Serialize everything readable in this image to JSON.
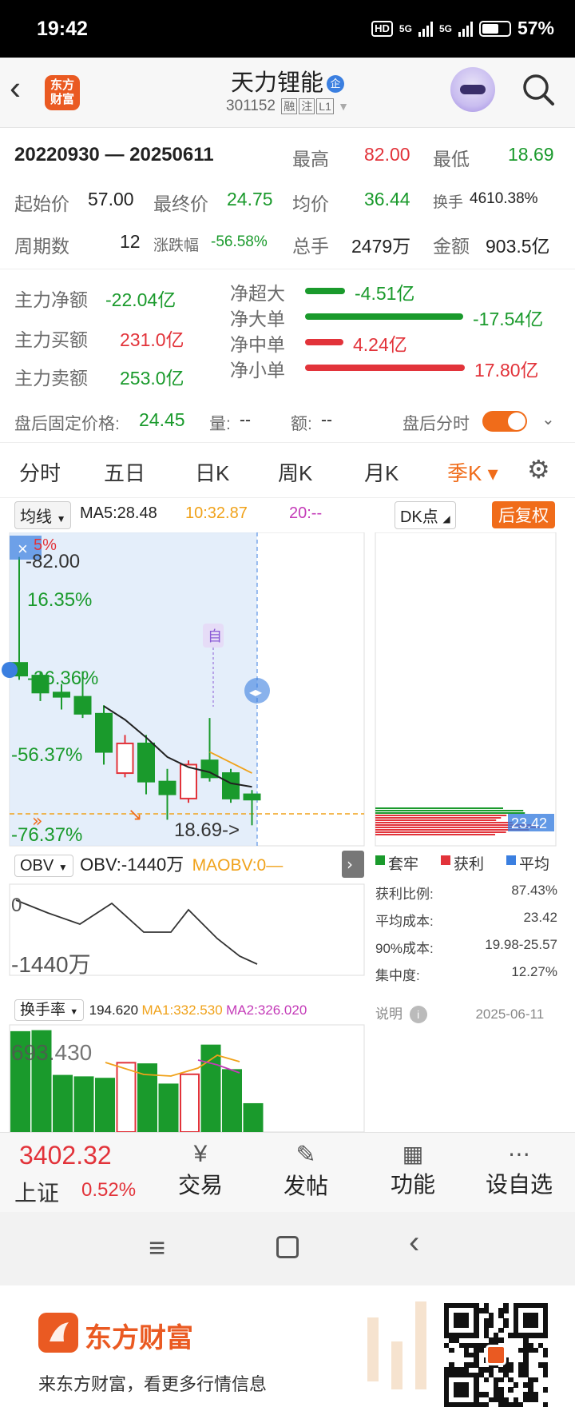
{
  "status_bar": {
    "time": "19:42",
    "hd": "HD",
    "net1": "5G",
    "net2": "5G",
    "battery": "57%"
  },
  "header": {
    "logo_text": "东方财富",
    "stock_name": "天力锂能",
    "qi_badge": "企",
    "code": "301152",
    "tags": [
      "融",
      "注",
      "L1"
    ]
  },
  "summary": {
    "date_range": "20220930 — 20250611",
    "high_label": "最高",
    "high": "82.00",
    "low_label": "最低",
    "low": "18.69",
    "open_label": "起始价",
    "open": "57.00",
    "close_label": "最终价",
    "close": "24.75",
    "avg_label": "均价",
    "avg": "36.44",
    "turnover_label": "换手",
    "turnover": "4610.38%",
    "periods_label": "周期数",
    "periods": "12",
    "change_label": "涨跌幅",
    "change": "-56.58%",
    "volume_label": "总手",
    "volume": "2479万",
    "amount_label": "金额",
    "amount": "903.5亿"
  },
  "fund_flow": {
    "net_main_label": "主力净额",
    "net_main": "-22.04亿",
    "buy_main_label": "主力买额",
    "buy_main": "231.0亿",
    "sell_main_label": "主力卖额",
    "sell_main": "253.0亿",
    "items": [
      {
        "label": "净超大",
        "value": "-4.51亿",
        "color": "#1a9a2c",
        "fraction": 0.25
      },
      {
        "label": "净大单",
        "value": "-17.54亿",
        "color": "#1a9a2c",
        "fraction": 0.99
      },
      {
        "label": "净中单",
        "value": "4.24亿",
        "color": "#e2333a",
        "fraction": 0.24
      },
      {
        "label": "净小单",
        "value": "17.80亿",
        "color": "#e2333a",
        "fraction": 1.0
      }
    ]
  },
  "after_hours": {
    "price_label": "盘后固定价格:",
    "price": "24.45",
    "vol_label": "量:",
    "vol": "--",
    "amt_label": "额:",
    "amt": "--",
    "toggle_label": "盘后分时"
  },
  "tabs": [
    "分时",
    "五日",
    "日K",
    "周K",
    "月K",
    "季K"
  ],
  "active_tab": "季K",
  "chart_toolbar": {
    "ma_select": "均线",
    "ma5": "MA5:28.48",
    "ma10": "10:32.87",
    "ma20": "20:--",
    "dk_select": "DK点",
    "adjust_button": "后复权"
  },
  "main_chart": {
    "labels": [
      "-82.00",
      "16.35%",
      "-36.36%",
      "-56.37%",
      "-76.37%",
      "18.69->",
      "5%",
      "自",
      "23.42"
    ],
    "colors": {
      "up": "#e2333a",
      "down": "#1a9a2c"
    }
  },
  "chart_data": {
    "type": "candlestick",
    "quarters": 12,
    "ohlc": [
      {
        "o": 57.0,
        "h": 82.0,
        "l": 53.0,
        "c": 54.0
      },
      {
        "o": 54.0,
        "h": 55.0,
        "l": 48.0,
        "c": 50.0
      },
      {
        "o": 50.0,
        "h": 52.0,
        "l": 46.0,
        "c": 49.0
      },
      {
        "o": 49.0,
        "h": 55.0,
        "l": 44.0,
        "c": 45.0
      },
      {
        "o": 45.0,
        "h": 47.0,
        "l": 33.0,
        "c": 36.0
      },
      {
        "o": 31.0,
        "h": 40.0,
        "l": 30.0,
        "c": 38.0
      },
      {
        "o": 38.0,
        "h": 40.0,
        "l": 26.0,
        "c": 29.0
      },
      {
        "o": 29.0,
        "h": 32.0,
        "l": 20.0,
        "c": 26.0
      },
      {
        "o": 25.0,
        "h": 34.0,
        "l": 24.0,
        "c": 33.0
      },
      {
        "o": 34.0,
        "h": 44.0,
        "l": 29.0,
        "c": 30.0
      },
      {
        "o": 31.0,
        "h": 32.0,
        "l": 24.0,
        "c": 25.0
      },
      {
        "o": 26.0,
        "h": 27.0,
        "l": 18.69,
        "c": 24.75
      }
    ],
    "ylim": [
      18.0,
      84.0
    ]
  },
  "chip_panel": {
    "legend": [
      "套牢",
      "获利",
      "平均"
    ],
    "legend_colors": [
      "#1a9a2c",
      "#e2333a",
      "#3b7fe0"
    ],
    "rows": [
      {
        "label": "获利比例:",
        "value": "87.43%"
      },
      {
        "label": "平均成本:",
        "value": "23.42"
      },
      {
        "label": "90%成本:",
        "value": "19.98-25.57"
      },
      {
        "label": "集中度:",
        "value": "12.27%"
      }
    ],
    "note_label": "说明",
    "date": "2025-06-11"
  },
  "obv": {
    "select": "OBV",
    "value": "OBV:-1440万",
    "ma": "MAOBV:0—",
    "top_label": "0",
    "bottom_label": "-1440万"
  },
  "turnover": {
    "select": "换手率",
    "value": "194.620",
    "ma1": "MA1:332.530",
    "ma2": "MA2:326.020",
    "label": "693.430",
    "values": [
      693,
      700,
      390,
      380,
      370,
      480,
      470,
      330,
      400,
      600,
      430,
      194
    ]
  },
  "bottom_nav": {
    "index_value": "3402.32",
    "index_name": "上证",
    "index_change": "0.52%",
    "items": [
      "交易",
      "发帖",
      "功能",
      "设自选"
    ]
  },
  "footer": {
    "brand": "东方财富",
    "slogan": "来东方财富，看更多行情信息"
  }
}
